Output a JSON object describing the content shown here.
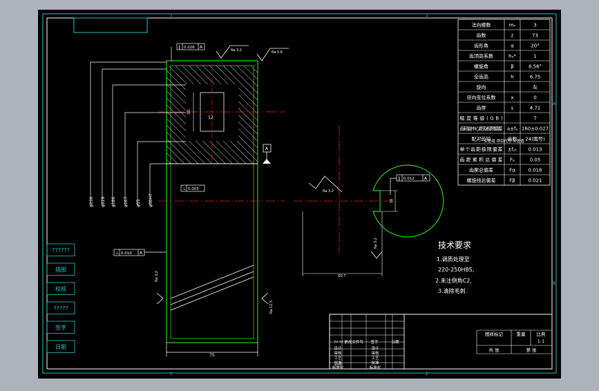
{
  "drawing": {
    "zone_marks": {
      "top": [
        "1",
        "2"
      ],
      "right": [
        "A",
        "B"
      ]
    },
    "title_box": "",
    "param_table": [
      [
        "法向模数",
        "mₙ",
        "3"
      ],
      [
        "齿数",
        "z",
        "73"
      ],
      [
        "齿形角",
        "α",
        "20°"
      ],
      [
        "齿顶高系数",
        "hₐ*",
        "1"
      ],
      [
        "螺旋角",
        "β",
        "8.56°"
      ],
      [
        "全齿高",
        "h",
        "6.75"
      ],
      [
        "旋向",
        "",
        "左"
      ],
      [
        "径向变位系数",
        "x",
        "0"
      ],
      [
        "齿厚",
        "s",
        "4.71"
      ],
      [
        "精度等级(GB)",
        "",
        "7"
      ],
      [
        "齿轮副中心距及极限偏差",
        "a±fₐ",
        "160±0.027"
      ],
      [
        "配对齿轮",
        "齿数",
        "24(图号)"
      ],
      [
        "单个齿距极限偏差",
        "±fₚₜ",
        "0.013"
      ],
      [
        "齿距累积总偏差",
        "Fₚ",
        "0.05"
      ],
      [
        "齿廓总偏差",
        "Fα",
        "0.018"
      ],
      [
        "螺旋线总偏差",
        "Fβ",
        "0.021"
      ]
    ],
    "param_table_extra": "公差组 项目代号 公差值",
    "tolerance_frames": [
      {
        "sym": "∥",
        "val": "0.026",
        "datum": "A"
      },
      {
        "sym": "⊥",
        "val": "0.003",
        "datum": ""
      },
      {
        "sym": "∥",
        "val": "0.012",
        "datum": "A"
      },
      {
        "sym": "⊥",
        "val": "0.010",
        "datum": "A"
      }
    ],
    "roughness": [
      "Ra 3.2",
      "Ra 1.6",
      "Ra 3.2",
      "Ra 3.2",
      "Ra 3.2",
      "Ra 12.5"
    ],
    "datum_label": "A",
    "dims": {
      "diameters": [
        "φ230",
        "φ229",
        "φ180",
        "φ167",
        "φ55",
        "φ50H7"
      ],
      "width": "75",
      "keyway_depth": "16",
      "hub": "30",
      "key_width": "12",
      "section_depth": "60.7",
      "tooth": "Ra 3.2"
    },
    "tech_req": {
      "title": "技术要求",
      "lines": [
        "1.调质处理至",
        "220-250HBS,",
        "2.未注倒角C2,",
        "3.清除毛刺."
      ]
    },
    "left_strip": [
      "??????",
      "描图",
      "校核",
      "?????",
      "签字",
      "日期"
    ],
    "title_block": {
      "cells": [
        "图样标记",
        "重量",
        "比例",
        "1:1",
        "共 张",
        "第 张"
      ],
      "revision": [
        "?? ??",
        "更改文件号",
        "签字",
        "日期"
      ],
      "signers": [
        "设计",
        "审核",
        "工艺",
        "批准",
        "标准化"
      ],
      "left_code": "????"
    }
  }
}
